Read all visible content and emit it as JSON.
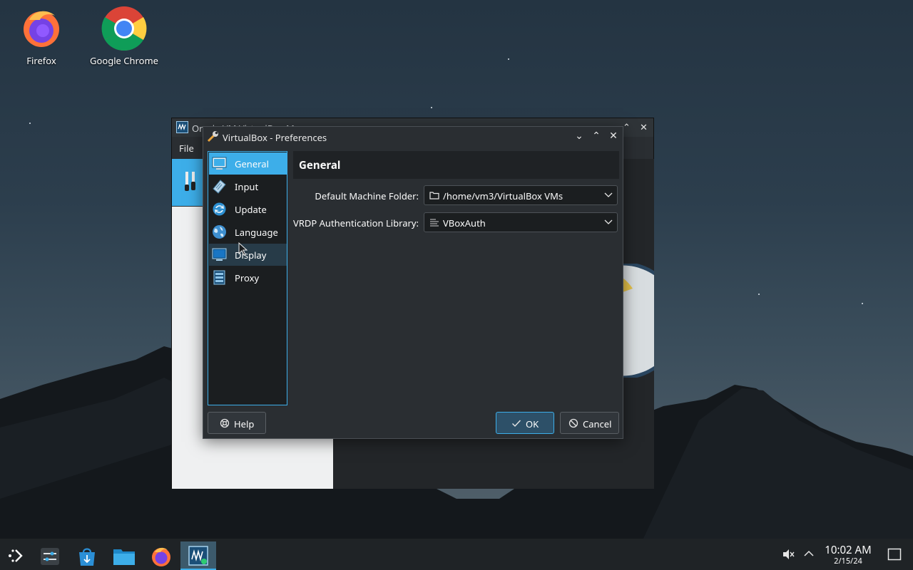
{
  "desktop": {
    "icons": [
      {
        "label": "Firefox"
      },
      {
        "label": "Google Chrome"
      }
    ]
  },
  "manager": {
    "title": "Oracle VM VirtualBox Manager",
    "menu_file": "File"
  },
  "dialog": {
    "title": "VirtualBox - Preferences",
    "sidebar": [
      {
        "label": "General",
        "icon": "monitor-icon",
        "selected": true
      },
      {
        "label": "Input",
        "icon": "keyboard-icon"
      },
      {
        "label": "Update",
        "icon": "refresh-icon"
      },
      {
        "label": "Language",
        "icon": "globe-icon"
      },
      {
        "label": "Display",
        "icon": "display-icon"
      },
      {
        "label": "Proxy",
        "icon": "server-icon"
      }
    ],
    "section_title": "General",
    "fields": {
      "machine_folder_label": "Default Machine Folder:",
      "machine_folder_value": "/home/vm3/VirtualBox VMs",
      "vrdp_label": "VRDP Authentication Library:",
      "vrdp_value": "VBoxAuth"
    },
    "buttons": {
      "help": "Help",
      "ok": "OK",
      "cancel": "Cancel"
    }
  },
  "taskbar": {
    "time": "10:02 AM",
    "date": "2/15/24"
  },
  "colors": {
    "accent": "#3daee9",
    "window_bg": "#2a2e32",
    "taskbar_bg": "#1f2326"
  }
}
